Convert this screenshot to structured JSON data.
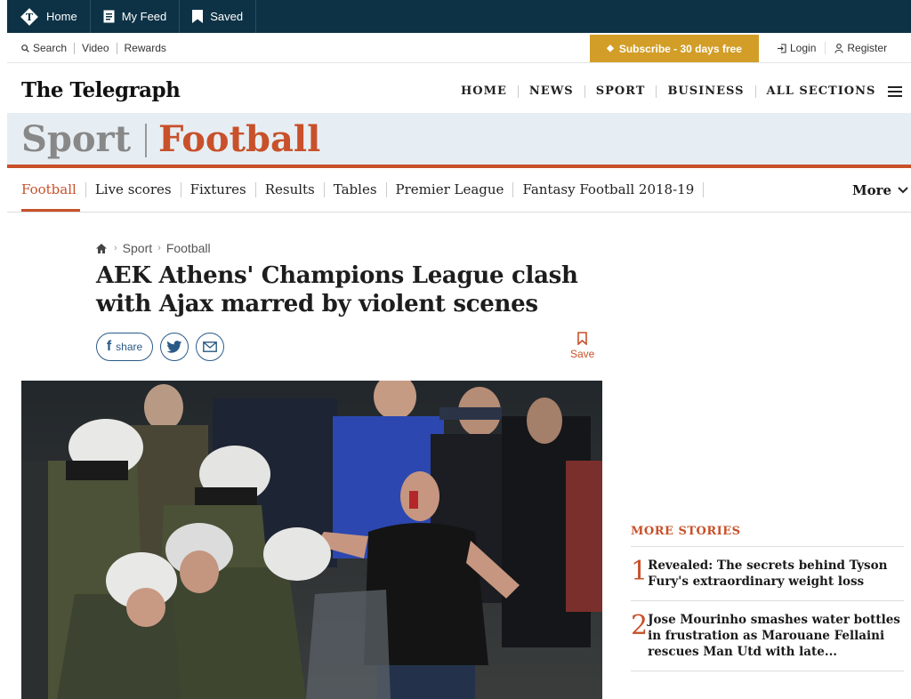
{
  "topbar": {
    "items": [
      {
        "label": "Home",
        "icon": "telegraph-t-icon"
      },
      {
        "label": "My Feed",
        "icon": "feed-icon"
      },
      {
        "label": "Saved",
        "icon": "bookmark-icon"
      }
    ]
  },
  "utility": {
    "left": [
      "Search",
      "Video",
      "Rewards"
    ],
    "subscribe": "Subscribe - 30 days free",
    "login": "Login",
    "register": "Register"
  },
  "masthead": {
    "logo": "The Telegraph",
    "nav": [
      "HOME",
      "NEWS",
      "SPORT",
      "BUSINESS",
      "ALL SECTIONS"
    ]
  },
  "banner": {
    "section": "Sport",
    "subsection": "Football"
  },
  "subnav": {
    "items": [
      "Football",
      "Live scores",
      "Fixtures",
      "Results",
      "Tables",
      "Premier League",
      "Fantasy Football 2018-19"
    ],
    "more": "More"
  },
  "breadcrumb": [
    "Sport",
    "Football"
  ],
  "article": {
    "headline": "AEK Athens' Champions League clash with Ajax marred by violent scenes",
    "share_label": "share",
    "save_label": "Save"
  },
  "more_stories": {
    "title": "MORE STORIES",
    "items": [
      {
        "num": "1",
        "text": "Revealed: The secrets behind Tyson Fury's extraordinary weight loss"
      },
      {
        "num": "2",
        "text": "Jose Mourinho smashes water bottles in frustration as Marouane Fellaini rescues Man Utd with late..."
      }
    ]
  },
  "colors": {
    "topbar": "#0d3246",
    "accent": "#c8502a",
    "subscribe": "#d29e28",
    "banner_bg": "#e7eef3"
  }
}
